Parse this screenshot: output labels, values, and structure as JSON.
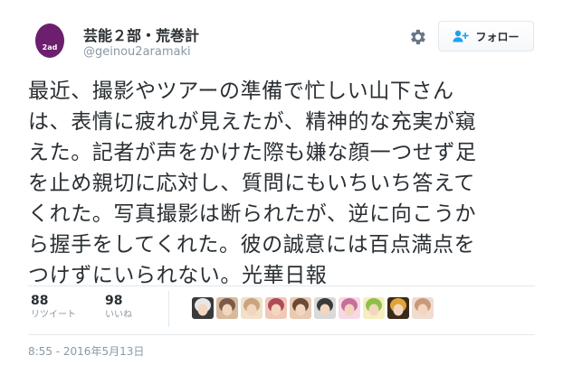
{
  "profile": {
    "display_name": "芸能２部・荒巻計",
    "handle": "@geinou2aramaki",
    "avatar_color": "#6b1f6e",
    "avatar_text": "2ad"
  },
  "actions": {
    "settings_icon": "gear-icon",
    "follow_label": "フォロー",
    "follow_icon": "add-user-icon",
    "accent_color": "#1da1f2"
  },
  "tweet": {
    "lines": [
      "最近、撮影やツアーの準備で忙しい山下さん",
      "は、表情に疲れが見えたが、精神的な充実が窺",
      "えた。記者が声をかけた際も嫌な顔一つせず足",
      "を止め親切に応対し、質問にもいちいち答えて",
      "くれた。写真撮影は断られたが、逆に向こうか",
      "ら握手をしてくれた。彼の誠意には百点満点を",
      "つけずにいられない。光華日報"
    ]
  },
  "stats": {
    "retweets": {
      "count": "88",
      "label": "リツイート"
    },
    "likes": {
      "count": "98",
      "label": "いいね"
    }
  },
  "likers": [
    {
      "name": "liker-avatar-1",
      "colors": [
        "#e8e8e8",
        "#3a3a3a"
      ]
    },
    {
      "name": "liker-avatar-2",
      "colors": [
        "#7a5a48",
        "#d9b99b"
      ]
    },
    {
      "name": "liker-avatar-3",
      "colors": [
        "#c9a47e",
        "#f2e0c8"
      ]
    },
    {
      "name": "liker-avatar-4",
      "colors": [
        "#b04a5a",
        "#f0c8b8"
      ]
    },
    {
      "name": "liker-avatar-5",
      "colors": [
        "#6b4a3a",
        "#e8cbb2"
      ]
    },
    {
      "name": "liker-avatar-6",
      "colors": [
        "#3a3a3a",
        "#d9d9d9"
      ]
    },
    {
      "name": "liker-avatar-7",
      "colors": [
        "#c86e9a",
        "#f7d9e6"
      ]
    },
    {
      "name": "liker-avatar-8",
      "colors": [
        "#8fbf4a",
        "#f4eec0"
      ]
    },
    {
      "name": "liker-avatar-9",
      "colors": [
        "#e0a23a",
        "#3a2a1a"
      ]
    },
    {
      "name": "liker-avatar-10",
      "colors": [
        "#c89a7a",
        "#f0ddd0"
      ]
    }
  ],
  "timestamp": "8:55 - 2016年5月13日"
}
